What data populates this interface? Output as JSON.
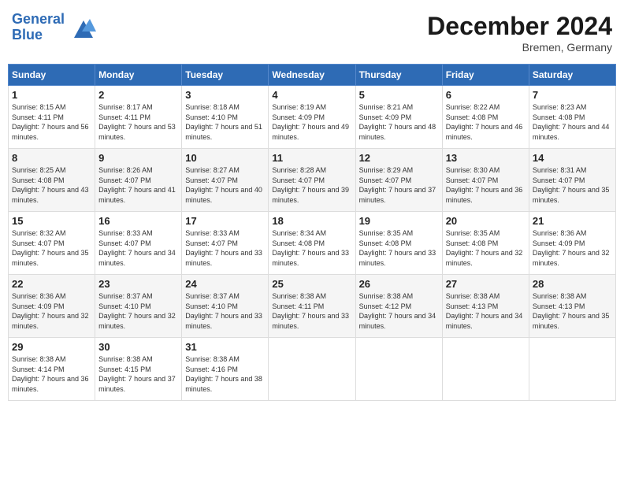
{
  "header": {
    "logo_line1": "General",
    "logo_line2": "Blue",
    "month": "December 2024",
    "location": "Bremen, Germany"
  },
  "weekdays": [
    "Sunday",
    "Monday",
    "Tuesday",
    "Wednesday",
    "Thursday",
    "Friday",
    "Saturday"
  ],
  "weeks": [
    [
      {
        "day": "1",
        "sunrise": "8:15 AM",
        "sunset": "4:11 PM",
        "daylight": "7 hours and 56 minutes."
      },
      {
        "day": "2",
        "sunrise": "8:17 AM",
        "sunset": "4:11 PM",
        "daylight": "7 hours and 53 minutes."
      },
      {
        "day": "3",
        "sunrise": "8:18 AM",
        "sunset": "4:10 PM",
        "daylight": "7 hours and 51 minutes."
      },
      {
        "day": "4",
        "sunrise": "8:19 AM",
        "sunset": "4:09 PM",
        "daylight": "7 hours and 49 minutes."
      },
      {
        "day": "5",
        "sunrise": "8:21 AM",
        "sunset": "4:09 PM",
        "daylight": "7 hours and 48 minutes."
      },
      {
        "day": "6",
        "sunrise": "8:22 AM",
        "sunset": "4:08 PM",
        "daylight": "7 hours and 46 minutes."
      },
      {
        "day": "7",
        "sunrise": "8:23 AM",
        "sunset": "4:08 PM",
        "daylight": "7 hours and 44 minutes."
      }
    ],
    [
      {
        "day": "8",
        "sunrise": "8:25 AM",
        "sunset": "4:08 PM",
        "daylight": "7 hours and 43 minutes."
      },
      {
        "day": "9",
        "sunrise": "8:26 AM",
        "sunset": "4:07 PM",
        "daylight": "7 hours and 41 minutes."
      },
      {
        "day": "10",
        "sunrise": "8:27 AM",
        "sunset": "4:07 PM",
        "daylight": "7 hours and 40 minutes."
      },
      {
        "day": "11",
        "sunrise": "8:28 AM",
        "sunset": "4:07 PM",
        "daylight": "7 hours and 39 minutes."
      },
      {
        "day": "12",
        "sunrise": "8:29 AM",
        "sunset": "4:07 PM",
        "daylight": "7 hours and 37 minutes."
      },
      {
        "day": "13",
        "sunrise": "8:30 AM",
        "sunset": "4:07 PM",
        "daylight": "7 hours and 36 minutes."
      },
      {
        "day": "14",
        "sunrise": "8:31 AM",
        "sunset": "4:07 PM",
        "daylight": "7 hours and 35 minutes."
      }
    ],
    [
      {
        "day": "15",
        "sunrise": "8:32 AM",
        "sunset": "4:07 PM",
        "daylight": "7 hours and 35 minutes."
      },
      {
        "day": "16",
        "sunrise": "8:33 AM",
        "sunset": "4:07 PM",
        "daylight": "7 hours and 34 minutes."
      },
      {
        "day": "17",
        "sunrise": "8:33 AM",
        "sunset": "4:07 PM",
        "daylight": "7 hours and 33 minutes."
      },
      {
        "day": "18",
        "sunrise": "8:34 AM",
        "sunset": "4:08 PM",
        "daylight": "7 hours and 33 minutes."
      },
      {
        "day": "19",
        "sunrise": "8:35 AM",
        "sunset": "4:08 PM",
        "daylight": "7 hours and 33 minutes."
      },
      {
        "day": "20",
        "sunrise": "8:35 AM",
        "sunset": "4:08 PM",
        "daylight": "7 hours and 32 minutes."
      },
      {
        "day": "21",
        "sunrise": "8:36 AM",
        "sunset": "4:09 PM",
        "daylight": "7 hours and 32 minutes."
      }
    ],
    [
      {
        "day": "22",
        "sunrise": "8:36 AM",
        "sunset": "4:09 PM",
        "daylight": "7 hours and 32 minutes."
      },
      {
        "day": "23",
        "sunrise": "8:37 AM",
        "sunset": "4:10 PM",
        "daylight": "7 hours and 32 minutes."
      },
      {
        "day": "24",
        "sunrise": "8:37 AM",
        "sunset": "4:10 PM",
        "daylight": "7 hours and 33 minutes."
      },
      {
        "day": "25",
        "sunrise": "8:38 AM",
        "sunset": "4:11 PM",
        "daylight": "7 hours and 33 minutes."
      },
      {
        "day": "26",
        "sunrise": "8:38 AM",
        "sunset": "4:12 PM",
        "daylight": "7 hours and 34 minutes."
      },
      {
        "day": "27",
        "sunrise": "8:38 AM",
        "sunset": "4:13 PM",
        "daylight": "7 hours and 34 minutes."
      },
      {
        "day": "28",
        "sunrise": "8:38 AM",
        "sunset": "4:13 PM",
        "daylight": "7 hours and 35 minutes."
      }
    ],
    [
      {
        "day": "29",
        "sunrise": "8:38 AM",
        "sunset": "4:14 PM",
        "daylight": "7 hours and 36 minutes."
      },
      {
        "day": "30",
        "sunrise": "8:38 AM",
        "sunset": "4:15 PM",
        "daylight": "7 hours and 37 minutes."
      },
      {
        "day": "31",
        "sunrise": "8:38 AM",
        "sunset": "4:16 PM",
        "daylight": "7 hours and 38 minutes."
      },
      null,
      null,
      null,
      null
    ]
  ]
}
